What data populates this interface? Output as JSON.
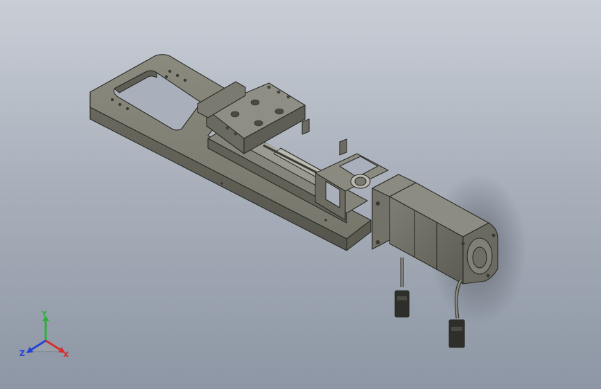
{
  "scene": {
    "background_top": "#c9ced6",
    "background_bottom": "#8d96a4",
    "part_color": "#7a7a6e",
    "edge_color": "#2a2a26",
    "motor_color": "#6f6f66"
  },
  "triad": {
    "y_label": "Y",
    "z_label": "Z",
    "x_label": "X",
    "y_color": "#2fae3a",
    "z_color": "#2443d6",
    "x_color": "#d62d2d"
  }
}
